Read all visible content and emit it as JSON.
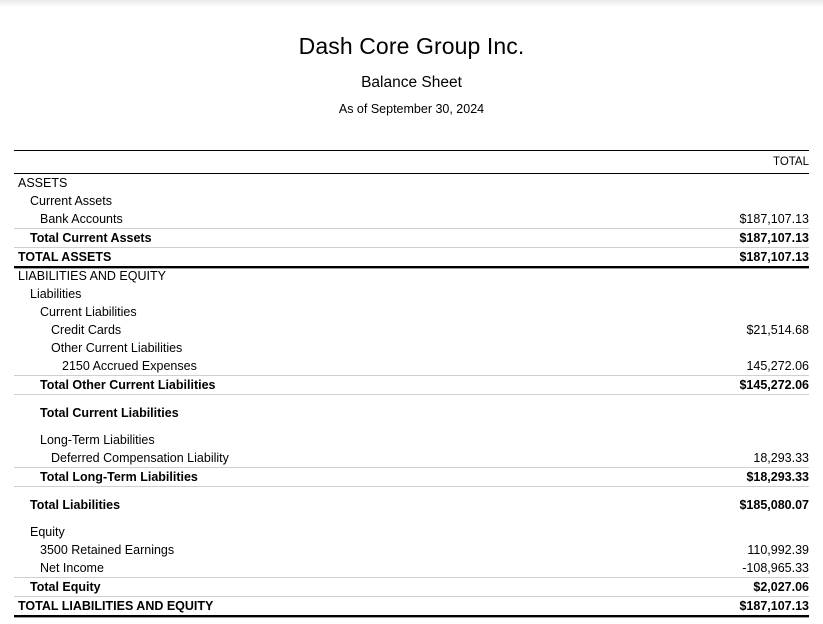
{
  "report": {
    "company": "Dash Core Group Inc.",
    "title": "Balance Sheet",
    "period": "As of September 30, 2024"
  },
  "table": {
    "column_header": "TOTAL",
    "rows": [
      {
        "label": "ASSETS",
        "amount": "",
        "indent": 0,
        "bold": false,
        "rule": "none",
        "gap": false
      },
      {
        "label": "Current Assets",
        "amount": "",
        "indent": 1,
        "bold": false,
        "rule": "none",
        "gap": false
      },
      {
        "label": "Bank Accounts",
        "amount": "$187,107.13",
        "indent": 2,
        "bold": false,
        "rule": "none",
        "gap": false
      },
      {
        "label": "Total Current Assets",
        "amount": "$187,107.13",
        "indent": 1,
        "bold": true,
        "rule": "light",
        "gap": false
      },
      {
        "label": "TOTAL ASSETS",
        "amount": "$187,107.13",
        "indent": 0,
        "bold": true,
        "rule": "light",
        "gap": false
      },
      {
        "label": "LIABILITIES AND EQUITY",
        "amount": "",
        "indent": 0,
        "bold": false,
        "rule": "double",
        "gap": false
      },
      {
        "label": "Liabilities",
        "amount": "",
        "indent": 1,
        "bold": false,
        "rule": "none",
        "gap": false
      },
      {
        "label": "Current Liabilities",
        "amount": "",
        "indent": 2,
        "bold": false,
        "rule": "none",
        "gap": false
      },
      {
        "label": "Credit Cards",
        "amount": "$21,514.68",
        "indent": 3,
        "bold": false,
        "rule": "none",
        "gap": false
      },
      {
        "label": "Other Current Liabilities",
        "amount": "",
        "indent": 3,
        "bold": false,
        "rule": "none",
        "gap": false
      },
      {
        "label": "2150 Accrued Expenses",
        "amount": "145,272.06",
        "indent": 4,
        "bold": false,
        "rule": "none",
        "gap": false
      },
      {
        "label": "Total Other Current Liabilities",
        "amount": "$145,272.06",
        "indent": 2,
        "bold": true,
        "rule": "light",
        "gap": false
      },
      {
        "label": "Total Current Liabilities",
        "amount": "",
        "indent": 2,
        "bold": true,
        "rule": "light",
        "gap": true
      },
      {
        "label": "Long-Term Liabilities",
        "amount": "",
        "indent": 2,
        "bold": false,
        "rule": "none",
        "gap": true
      },
      {
        "label": "Deferred Compensation Liability",
        "amount": "18,293.33",
        "indent": 3,
        "bold": false,
        "rule": "none",
        "gap": false
      },
      {
        "label": "Total Long-Term Liabilities",
        "amount": "$18,293.33",
        "indent": 2,
        "bold": true,
        "rule": "light",
        "gap": false
      },
      {
        "label": "Total Liabilities",
        "amount": "$185,080.07",
        "indent": 1,
        "bold": true,
        "rule": "light",
        "gap": true
      },
      {
        "label": "Equity",
        "amount": "",
        "indent": 1,
        "bold": false,
        "rule": "none",
        "gap": true
      },
      {
        "label": "3500 Retained Earnings",
        "amount": "110,992.39",
        "indent": 2,
        "bold": false,
        "rule": "none",
        "gap": false
      },
      {
        "label": "Net Income",
        "amount": "-108,965.33",
        "indent": 2,
        "bold": false,
        "rule": "none",
        "gap": false
      },
      {
        "label": "Total Equity",
        "amount": "$2,027.06",
        "indent": 1,
        "bold": true,
        "rule": "light",
        "gap": false
      },
      {
        "label": "TOTAL LIABILITIES AND EQUITY",
        "amount": "$187,107.13",
        "indent": 0,
        "bold": true,
        "rule": "light",
        "gap": false
      }
    ]
  }
}
